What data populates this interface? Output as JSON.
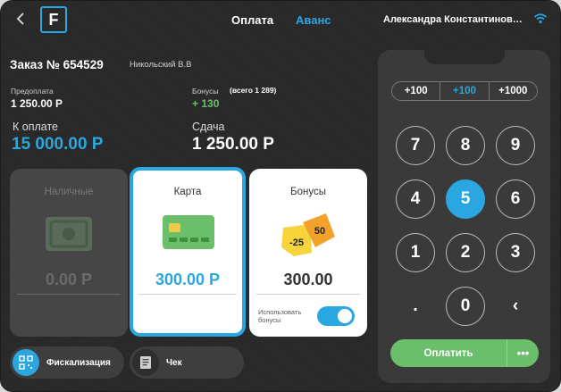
{
  "header": {
    "back_icon": "chevron-left-icon",
    "logo_letter": "F",
    "tabs": [
      {
        "label": "Оплата",
        "active": false
      },
      {
        "label": "Аванс",
        "active": true
      }
    ],
    "user_name": "Александра Константинов…",
    "wifi_icon": "wifi-icon"
  },
  "order": {
    "title": "Заказ № 654529",
    "manager": "Никольский В.В",
    "prepay_label": "Предоплата",
    "prepay_value": "1 250.00 Р",
    "bonus_label": "Бонусы",
    "bonus_total": "(всего 1 289)",
    "bonus_value": "+ 130",
    "to_pay_label": "К оплате",
    "to_pay_value": "15 000.00 Р",
    "change_label": "Сдача",
    "change_value": "1 250.00 Р"
  },
  "methods": {
    "cash": {
      "title": "Наличные",
      "amount": "0.00 Р",
      "icon": "banknote-icon"
    },
    "card": {
      "title": "Карта",
      "amount": "300.00 Р",
      "icon": "credit-card-icon"
    },
    "bonus": {
      "title": "Бонусы",
      "amount": "300.00",
      "icon": "discount-tags-icon",
      "tag1": "-25",
      "tag2": "50",
      "toggle_label": "Использовать бонусы",
      "toggle_on": true
    }
  },
  "footer": {
    "fiscal_label": "Фискализация",
    "receipt_label": "Чек"
  },
  "keypad": {
    "presets": [
      "+100",
      "+100",
      "+1000"
    ],
    "active_preset": 1,
    "keys": [
      "7",
      "8",
      "9",
      "4",
      "5",
      "6",
      "1",
      "2",
      "3",
      ".",
      "0",
      "‹"
    ],
    "active_key": "5",
    "pay_label": "Оплатить",
    "more_label": "•••"
  },
  "colors": {
    "accent": "#2aa7e0",
    "pay": "#6cbf6a",
    "bonus_green": "#6cbf6a"
  }
}
